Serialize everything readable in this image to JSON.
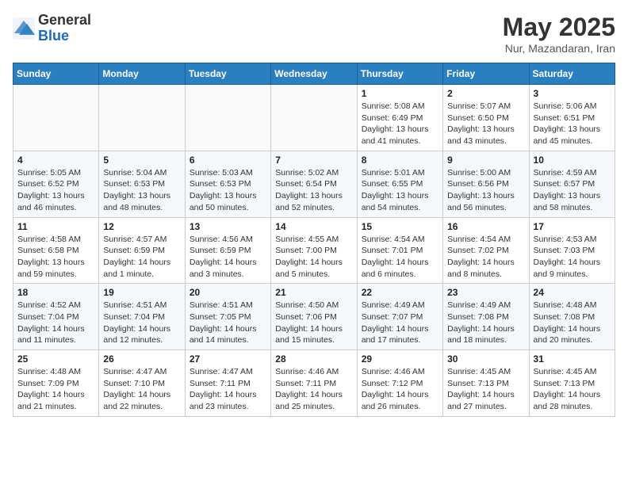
{
  "header": {
    "logo_general": "General",
    "logo_blue": "Blue",
    "month_title": "May 2025",
    "location": "Nur, Mazandaran, Iran"
  },
  "days_of_week": [
    "Sunday",
    "Monday",
    "Tuesday",
    "Wednesday",
    "Thursday",
    "Friday",
    "Saturday"
  ],
  "weeks": [
    [
      {
        "day": "",
        "info": ""
      },
      {
        "day": "",
        "info": ""
      },
      {
        "day": "",
        "info": ""
      },
      {
        "day": "",
        "info": ""
      },
      {
        "day": "1",
        "info": "Sunrise: 5:08 AM\nSunset: 6:49 PM\nDaylight: 13 hours\nand 41 minutes."
      },
      {
        "day": "2",
        "info": "Sunrise: 5:07 AM\nSunset: 6:50 PM\nDaylight: 13 hours\nand 43 minutes."
      },
      {
        "day": "3",
        "info": "Sunrise: 5:06 AM\nSunset: 6:51 PM\nDaylight: 13 hours\nand 45 minutes."
      }
    ],
    [
      {
        "day": "4",
        "info": "Sunrise: 5:05 AM\nSunset: 6:52 PM\nDaylight: 13 hours\nand 46 minutes."
      },
      {
        "day": "5",
        "info": "Sunrise: 5:04 AM\nSunset: 6:53 PM\nDaylight: 13 hours\nand 48 minutes."
      },
      {
        "day": "6",
        "info": "Sunrise: 5:03 AM\nSunset: 6:53 PM\nDaylight: 13 hours\nand 50 minutes."
      },
      {
        "day": "7",
        "info": "Sunrise: 5:02 AM\nSunset: 6:54 PM\nDaylight: 13 hours\nand 52 minutes."
      },
      {
        "day": "8",
        "info": "Sunrise: 5:01 AM\nSunset: 6:55 PM\nDaylight: 13 hours\nand 54 minutes."
      },
      {
        "day": "9",
        "info": "Sunrise: 5:00 AM\nSunset: 6:56 PM\nDaylight: 13 hours\nand 56 minutes."
      },
      {
        "day": "10",
        "info": "Sunrise: 4:59 AM\nSunset: 6:57 PM\nDaylight: 13 hours\nand 58 minutes."
      }
    ],
    [
      {
        "day": "11",
        "info": "Sunrise: 4:58 AM\nSunset: 6:58 PM\nDaylight: 13 hours\nand 59 minutes."
      },
      {
        "day": "12",
        "info": "Sunrise: 4:57 AM\nSunset: 6:59 PM\nDaylight: 14 hours\nand 1 minute."
      },
      {
        "day": "13",
        "info": "Sunrise: 4:56 AM\nSunset: 6:59 PM\nDaylight: 14 hours\nand 3 minutes."
      },
      {
        "day": "14",
        "info": "Sunrise: 4:55 AM\nSunset: 7:00 PM\nDaylight: 14 hours\nand 5 minutes."
      },
      {
        "day": "15",
        "info": "Sunrise: 4:54 AM\nSunset: 7:01 PM\nDaylight: 14 hours\nand 6 minutes."
      },
      {
        "day": "16",
        "info": "Sunrise: 4:54 AM\nSunset: 7:02 PM\nDaylight: 14 hours\nand 8 minutes."
      },
      {
        "day": "17",
        "info": "Sunrise: 4:53 AM\nSunset: 7:03 PM\nDaylight: 14 hours\nand 9 minutes."
      }
    ],
    [
      {
        "day": "18",
        "info": "Sunrise: 4:52 AM\nSunset: 7:04 PM\nDaylight: 14 hours\nand 11 minutes."
      },
      {
        "day": "19",
        "info": "Sunrise: 4:51 AM\nSunset: 7:04 PM\nDaylight: 14 hours\nand 12 minutes."
      },
      {
        "day": "20",
        "info": "Sunrise: 4:51 AM\nSunset: 7:05 PM\nDaylight: 14 hours\nand 14 minutes."
      },
      {
        "day": "21",
        "info": "Sunrise: 4:50 AM\nSunset: 7:06 PM\nDaylight: 14 hours\nand 15 minutes."
      },
      {
        "day": "22",
        "info": "Sunrise: 4:49 AM\nSunset: 7:07 PM\nDaylight: 14 hours\nand 17 minutes."
      },
      {
        "day": "23",
        "info": "Sunrise: 4:49 AM\nSunset: 7:08 PM\nDaylight: 14 hours\nand 18 minutes."
      },
      {
        "day": "24",
        "info": "Sunrise: 4:48 AM\nSunset: 7:08 PM\nDaylight: 14 hours\nand 20 minutes."
      }
    ],
    [
      {
        "day": "25",
        "info": "Sunrise: 4:48 AM\nSunset: 7:09 PM\nDaylight: 14 hours\nand 21 minutes."
      },
      {
        "day": "26",
        "info": "Sunrise: 4:47 AM\nSunset: 7:10 PM\nDaylight: 14 hours\nand 22 minutes."
      },
      {
        "day": "27",
        "info": "Sunrise: 4:47 AM\nSunset: 7:11 PM\nDaylight: 14 hours\nand 23 minutes."
      },
      {
        "day": "28",
        "info": "Sunrise: 4:46 AM\nSunset: 7:11 PM\nDaylight: 14 hours\nand 25 minutes."
      },
      {
        "day": "29",
        "info": "Sunrise: 4:46 AM\nSunset: 7:12 PM\nDaylight: 14 hours\nand 26 minutes."
      },
      {
        "day": "30",
        "info": "Sunrise: 4:45 AM\nSunset: 7:13 PM\nDaylight: 14 hours\nand 27 minutes."
      },
      {
        "day": "31",
        "info": "Sunrise: 4:45 AM\nSunset: 7:13 PM\nDaylight: 14 hours\nand 28 minutes."
      }
    ]
  ]
}
